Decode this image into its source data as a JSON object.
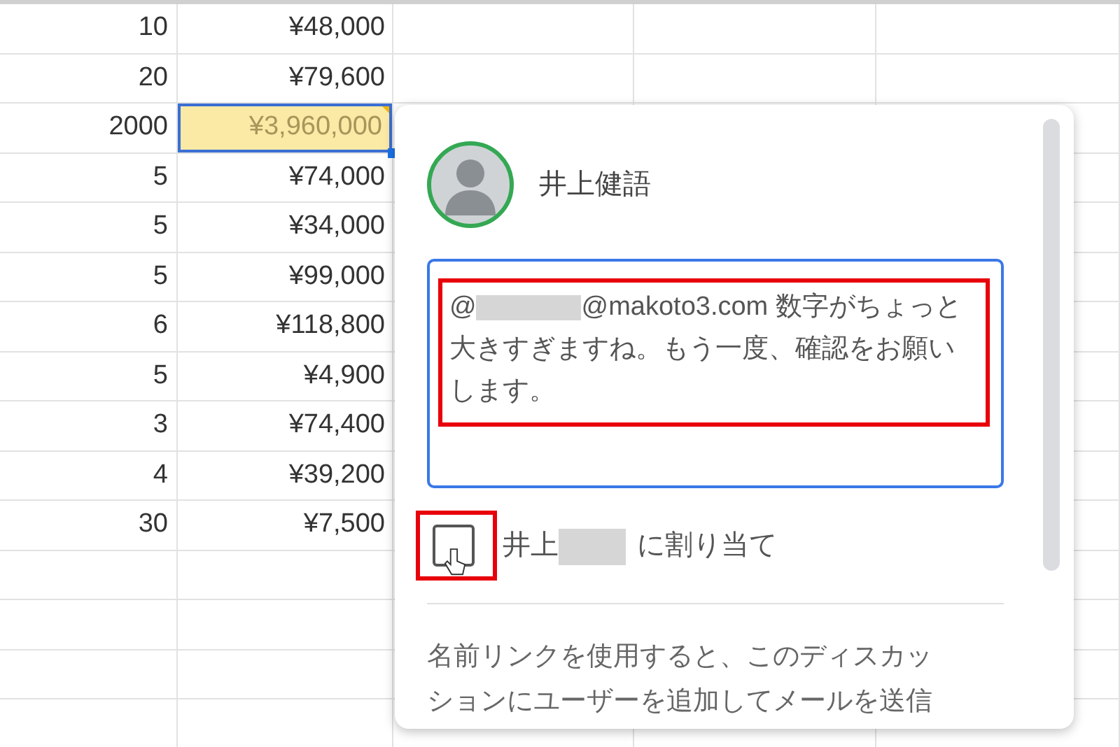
{
  "sheet": {
    "rows": [
      {
        "qty": "10",
        "amount": "¥48,000",
        "selected": false
      },
      {
        "qty": "20",
        "amount": "¥79,600",
        "selected": false
      },
      {
        "qty": "2000",
        "amount": "¥3,960,000",
        "selected": true
      },
      {
        "qty": "5",
        "amount": "¥74,000",
        "selected": false
      },
      {
        "qty": "5",
        "amount": "¥34,000",
        "selected": false
      },
      {
        "qty": "5",
        "amount": "¥99,000",
        "selected": false
      },
      {
        "qty": "6",
        "amount": "¥118,800",
        "selected": false
      },
      {
        "qty": "5",
        "amount": "¥4,900",
        "selected": false
      },
      {
        "qty": "3",
        "amount": "¥74,400",
        "selected": false
      },
      {
        "qty": "4",
        "amount": "¥39,200",
        "selected": false
      },
      {
        "qty": "30",
        "amount": "¥7,500",
        "selected": false
      }
    ]
  },
  "comment": {
    "author": "井上健語",
    "message": {
      "prefix": "@",
      "redacted": true,
      "text": "@makoto3.com 数字がちょっと大きすぎますね。もう一度、確認をお願いします。"
    },
    "assign": {
      "checked": false,
      "before": "井上",
      "redacted": true,
      "after": "に割り当て"
    },
    "help": "名前リンクを使用すると、このディスカッションにユーザーを追加してメールを送信"
  }
}
